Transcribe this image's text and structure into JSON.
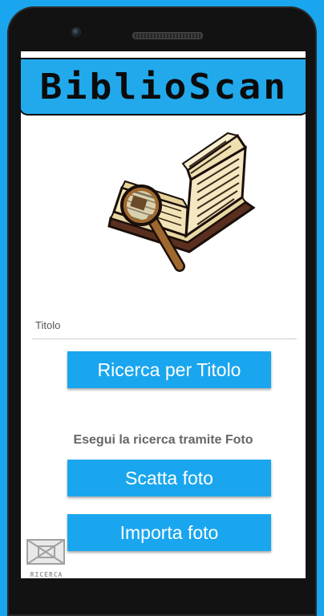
{
  "app": {
    "title": "BiblioScan"
  },
  "search": {
    "placeholder": "Titolo",
    "value": "",
    "button_label": "Ricerca per Titolo"
  },
  "photo": {
    "hint": "Esegui la ricerca tramite Foto",
    "shot_label": "Scatta foto",
    "import_label": "Importa foto"
  },
  "corner_logo": {
    "text": "RICERCA"
  },
  "colors": {
    "accent": "#1aa6ee",
    "device_frame": "#121212",
    "hint_text": "#666666"
  },
  "icons": {
    "illustration": "open-book-with-magnifying-glass",
    "corner": "search-logo"
  }
}
